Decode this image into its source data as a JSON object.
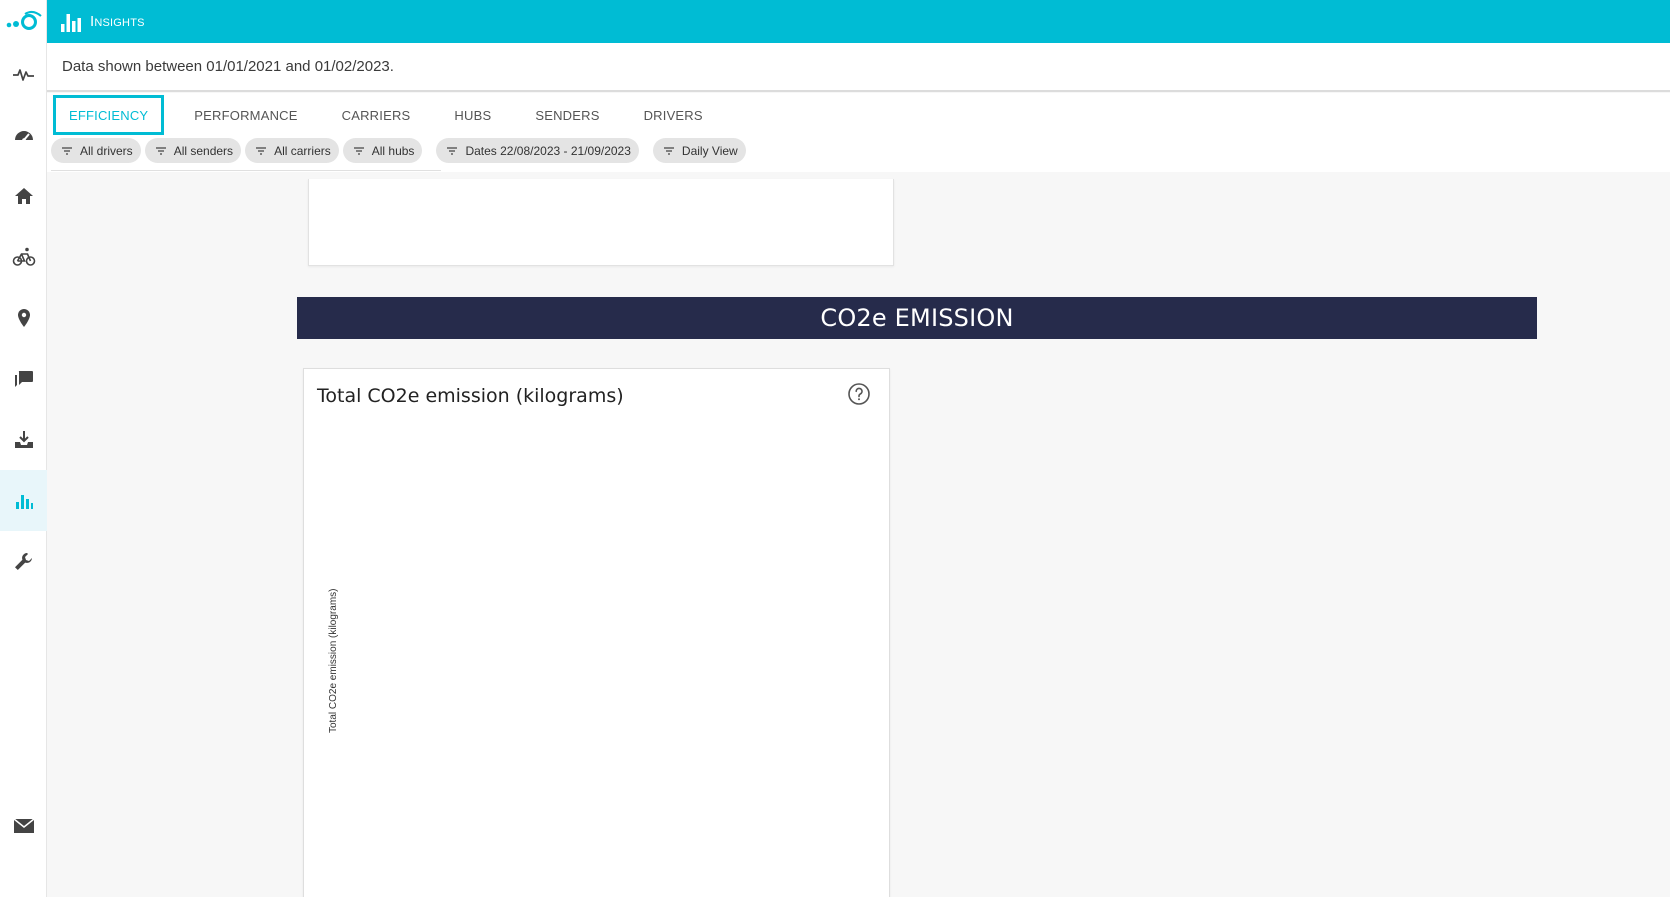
{
  "app": {
    "section_title": "Insights"
  },
  "rail": {
    "items": [
      {
        "icon": "activity-icon"
      },
      {
        "icon": "speedometer-icon"
      },
      {
        "icon": "home-icon"
      },
      {
        "icon": "bicycle-icon"
      },
      {
        "icon": "map-pin-icon"
      },
      {
        "icon": "chat-icon"
      },
      {
        "icon": "inbox-download-icon"
      },
      {
        "icon": "bar-chart-icon",
        "active": true
      },
      {
        "icon": "wrench-icon"
      }
    ],
    "bottom_icon": "mail-icon"
  },
  "info": {
    "text": "Data shown between 01/01/2021 and 01/02/2023."
  },
  "tabs": [
    {
      "label": "EFFICIENCY",
      "active": true
    },
    {
      "label": "PERFORMANCE"
    },
    {
      "label": "CARRIERS"
    },
    {
      "label": "HUBS"
    },
    {
      "label": "SENDERS"
    },
    {
      "label": "DRIVERS"
    }
  ],
  "filters": [
    {
      "label": "All drivers"
    },
    {
      "label": "All senders"
    },
    {
      "label": "All carriers"
    },
    {
      "label": "All hubs"
    },
    {
      "label": "Dates 22/08/2023 - 21/09/2023"
    },
    {
      "label": "Daily View"
    }
  ],
  "section": {
    "banner": "CO2e EMISSION"
  },
  "chart": {
    "title": "Total CO2e emission (kilograms)",
    "ylabel": "Total CO2e emission (kilograms)"
  },
  "colors": {
    "accent": "#00bcd4",
    "banner": "#262b4b"
  }
}
